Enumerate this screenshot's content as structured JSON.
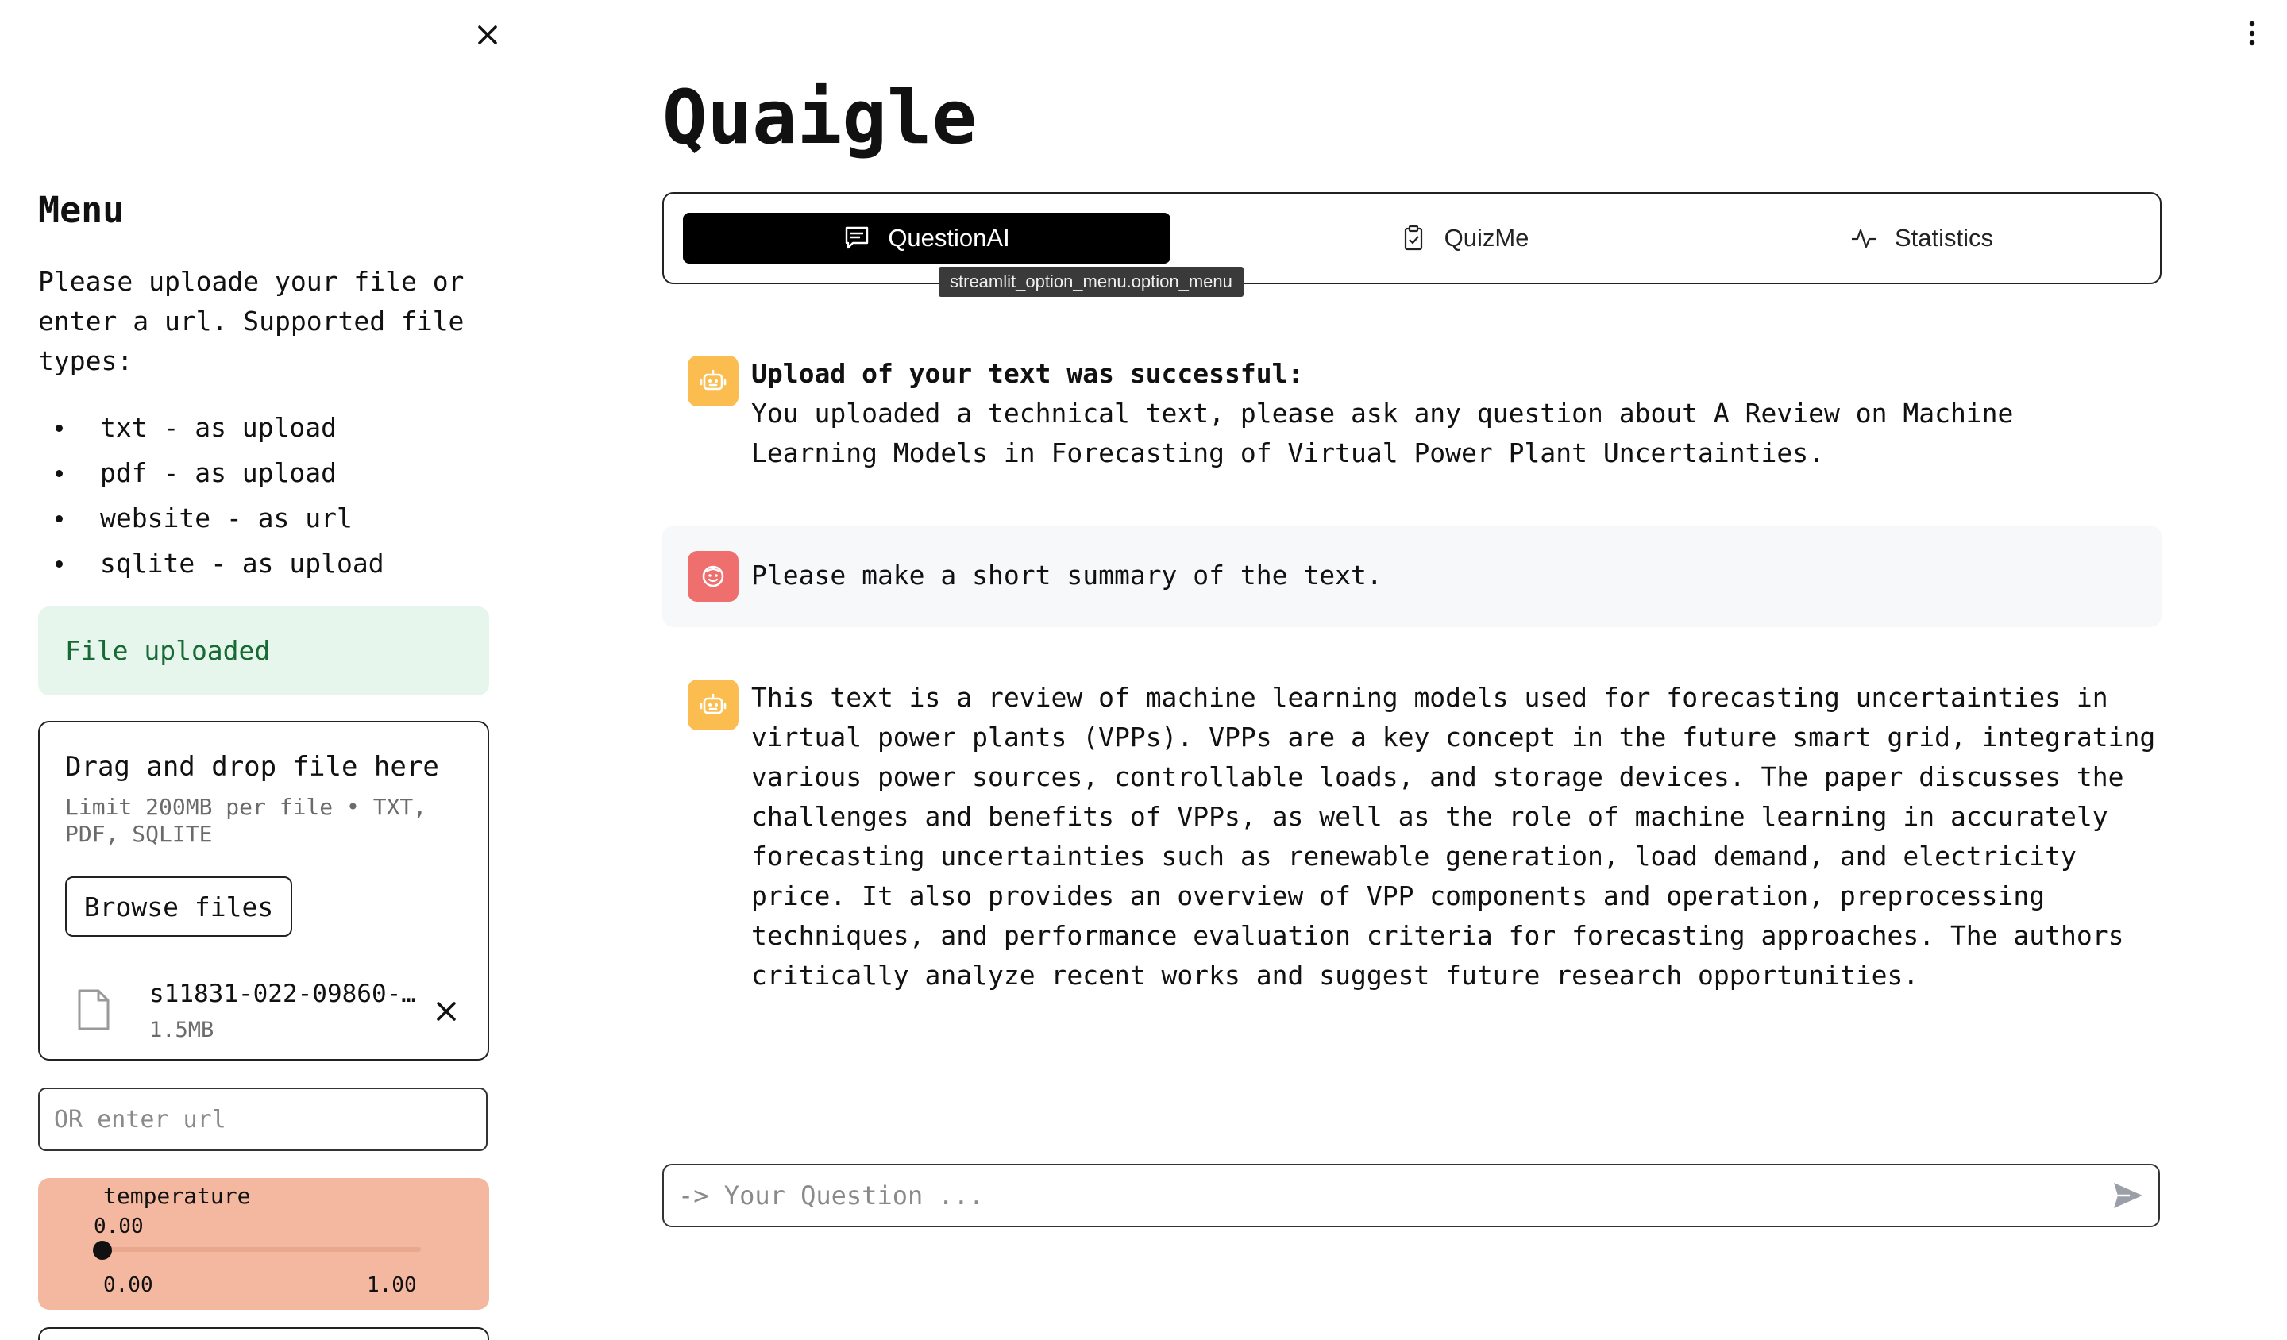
{
  "sidebar": {
    "menu_title": "Menu",
    "description": "Please uploade your file or enter a url. Supported file types:",
    "file_types": [
      "txt - as upload",
      "pdf - as upload",
      "website - as url",
      "sqlite - as upload"
    ],
    "success_message": "File uploaded",
    "uploader": {
      "drop_title": "Drag and drop file here",
      "limit_text": "Limit 200MB per file • TXT, PDF, SQLITE",
      "browse_label": "Browse files",
      "file_name": "s11831-022-09860-…",
      "file_size": "1.5MB"
    },
    "url_input": {
      "placeholder": "OR enter url"
    },
    "temperature": {
      "label": "temperature",
      "value": "0.00",
      "min": "0.00",
      "max": "1.00",
      "level": 0.0
    }
  },
  "app": {
    "title": "Quaigle"
  },
  "tabs": [
    {
      "label": "QuestionAI",
      "icon": "chat-icon",
      "active": true
    },
    {
      "label": "QuizMe",
      "icon": "clipboard-check-icon",
      "active": false
    },
    {
      "label": "Statistics",
      "icon": "activity-icon",
      "active": false
    }
  ],
  "tooltip": "streamlit_option_menu.option_menu",
  "messages": [
    {
      "role": "assistant",
      "avatar": "bot-icon",
      "title": "Upload of your text was successful:",
      "text": "You uploaded a technical text, please ask any question about A Review on Machine Learning Models in Forecasting of Virtual Power Plant Uncertainties."
    },
    {
      "role": "user",
      "avatar": "user-face-icon",
      "text": "Please make a short summary of the text."
    },
    {
      "role": "assistant",
      "avatar": "bot-icon",
      "text": "This text is a review of machine learning models used for forecasting uncertainties in virtual power plants (VPPs). VPPs are a key concept in the future smart grid, integrating various power sources, controllable loads, and storage devices. The paper discusses the challenges and benefits of VPPs, as well as the role of machine learning in accurately forecasting uncertainties such as renewable generation, load demand, and electricity price. It also provides an overview of VPP components and operation, preprocessing techniques, and performance evaluation criteria for forecasting approaches. The authors critically analyze recent works and suggest future research opportunities."
    }
  ],
  "chat_input": {
    "placeholder": "-> Your Question ..."
  },
  "colors": {
    "bot_avatar": "#fbbd4f",
    "user_avatar": "#ef6e6e",
    "success_bg": "#e7f6ec",
    "success_text": "#176a34",
    "temperature_bg": "#f4b8a0",
    "active_tab": "#000000"
  }
}
